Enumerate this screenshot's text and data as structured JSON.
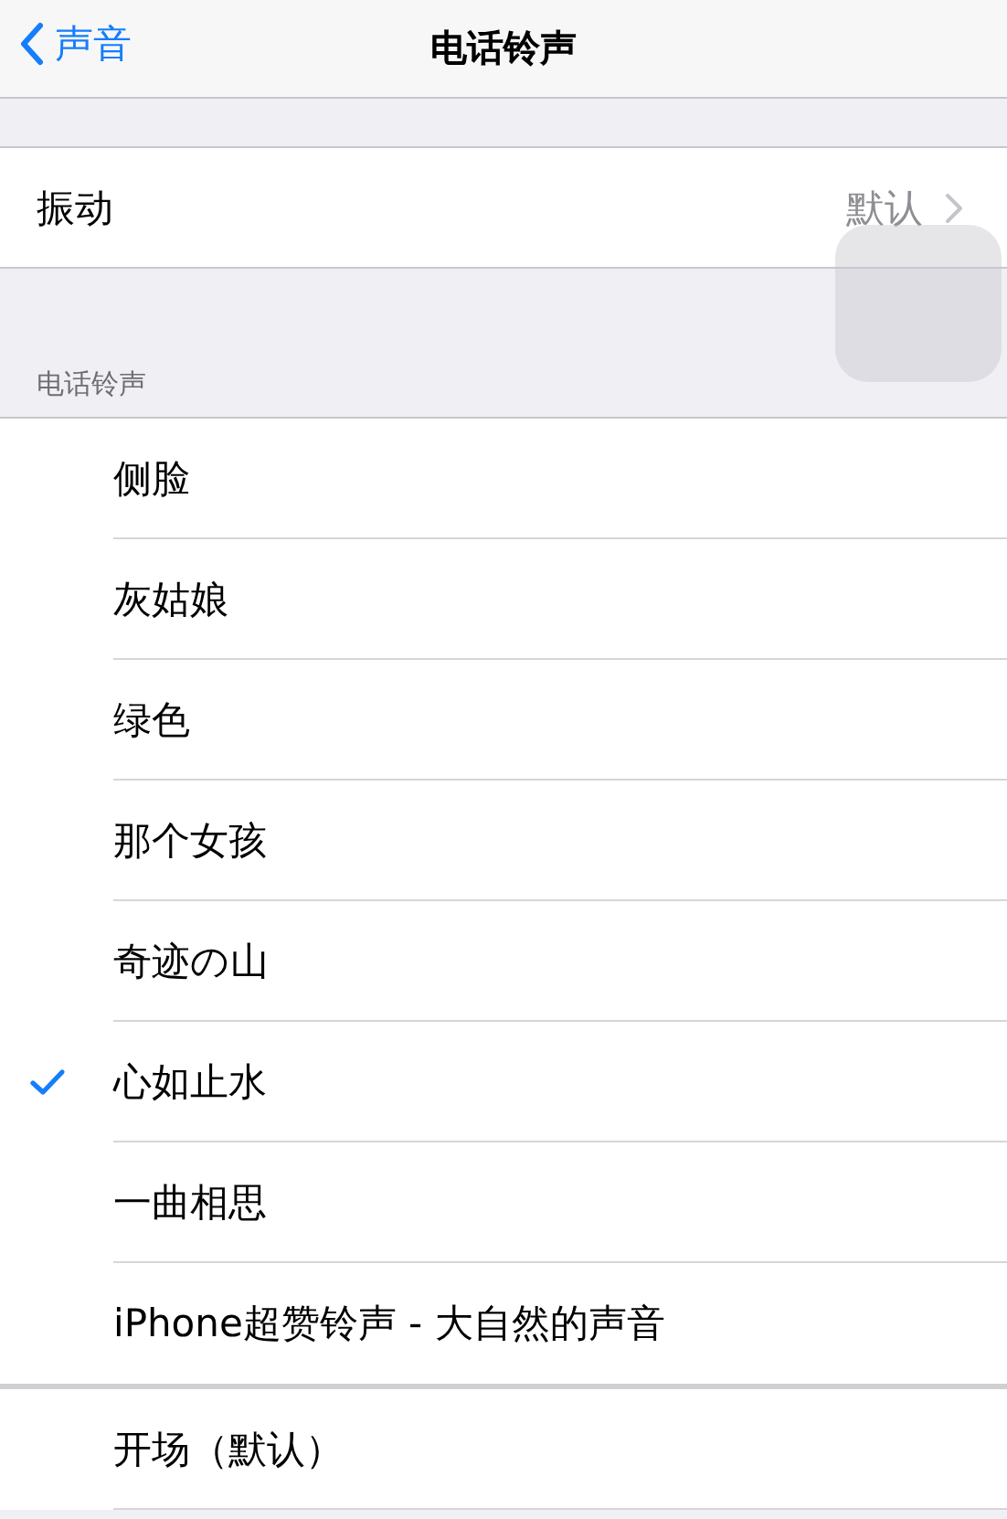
{
  "nav": {
    "back": "声音",
    "title": "电话铃声"
  },
  "vibration": {
    "label": "振动",
    "value": "默认"
  },
  "section_header": "电话铃声",
  "ringtones": [
    {
      "name": "侧脸",
      "selected": false
    },
    {
      "name": "灰姑娘",
      "selected": false
    },
    {
      "name": "绿色",
      "selected": false
    },
    {
      "name": "那个女孩",
      "selected": false
    },
    {
      "name": "奇迹の山",
      "selected": false
    },
    {
      "name": "心如止水",
      "selected": true
    },
    {
      "name": "一曲相思",
      "selected": false
    },
    {
      "name": "iPhone超赞铃声 - 大自然的声音",
      "selected": false
    }
  ],
  "default_tones": [
    {
      "name": "开场（默认）",
      "selected": false
    }
  ]
}
